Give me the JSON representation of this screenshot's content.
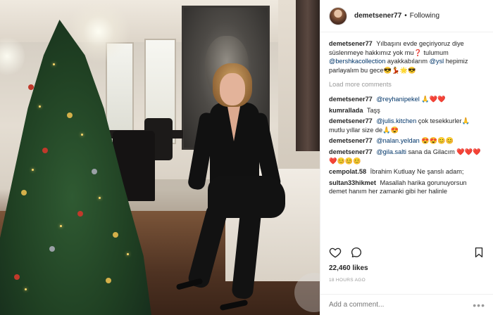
{
  "post": {
    "username": "demetsener77",
    "follow_status": "Following",
    "header_separator": "•",
    "caption": {
      "user": "demetsener77",
      "text_before": "Yılbaşını evde geçiriyoruz diye süslenmeye hakkımız yok mu❓ tulumum",
      "mention1": "@bershkacollection",
      "text_mid": "ayakkabılarım",
      "mention2": "@ysl",
      "text_after": "hepimiz parlayalım bu gece😎💃🌟😎"
    },
    "load_more": "Load more comments",
    "comments": [
      {
        "user": "demetsener77",
        "mention": "@reyhanipekel",
        "text": "🙏❤️❤️"
      },
      {
        "user": "kumrallada",
        "mention": "",
        "text": "Taşş"
      },
      {
        "user": "demetsener77",
        "mention": "@julis.kitchen",
        "text": "çok tesekkurler🙏mutlu yıllar size de🙏😍"
      },
      {
        "user": "demetsener77",
        "mention": "@nalan.yeldan",
        "text": "😍😍😊😊"
      },
      {
        "user": "demetsener77",
        "mention": "@gila.salti",
        "text": "sana da Gilacım ❤️❤️❤️❤️😊😊😊"
      },
      {
        "user": "cempolat.58",
        "mention": "",
        "text": "İbrahim Kutluay Ne şanslı adam;"
      },
      {
        "user": "sultan33hikmet",
        "mention": "",
        "text": "Masallah harika gorunuyorsun demet hanım her zamanki gibi her halinle"
      }
    ],
    "likes": "22,460 likes",
    "time": "18 HOURS AGO",
    "add_comment_placeholder": "Add a comment...",
    "more_label": "•••"
  },
  "icons": {
    "heart": "heart-icon",
    "comment": "comment-icon",
    "bookmark": "bookmark-icon"
  },
  "watermark": "b"
}
